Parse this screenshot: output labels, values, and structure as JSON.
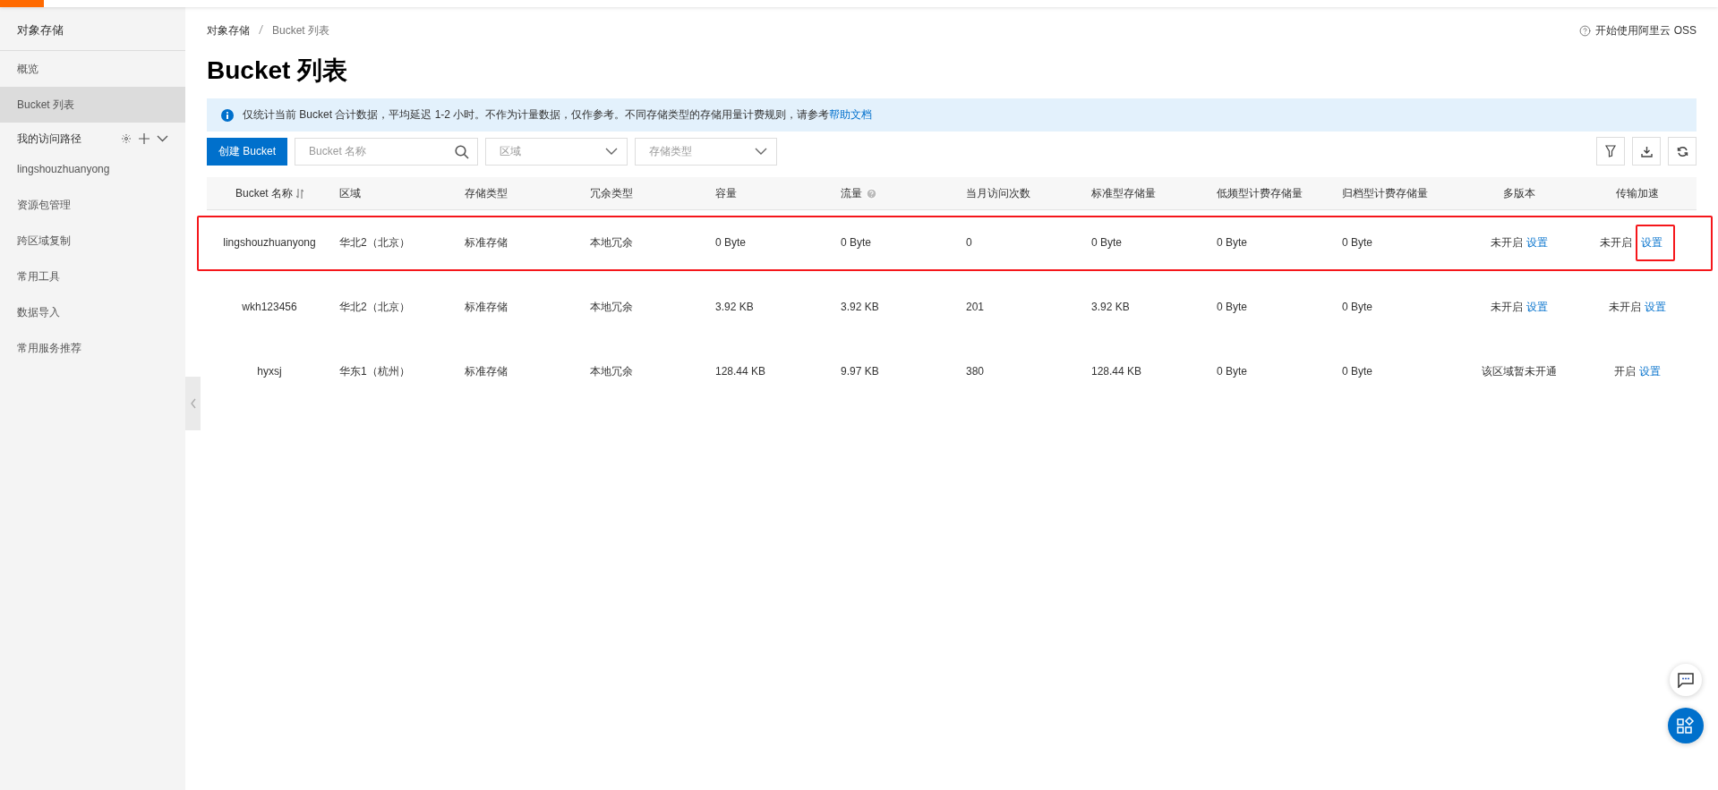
{
  "sidebar": {
    "title": "对象存储",
    "items": [
      {
        "label": "概览",
        "selected": false,
        "kind": "link"
      },
      {
        "label": "Bucket 列表",
        "selected": true,
        "kind": "link"
      },
      {
        "label": "我的访问路径",
        "selected": false,
        "kind": "group"
      },
      {
        "label": "lingshouzhuanyong",
        "selected": false,
        "kind": "link"
      },
      {
        "label": "资源包管理",
        "selected": false,
        "kind": "link"
      },
      {
        "label": "跨区域复制",
        "selected": false,
        "kind": "link"
      },
      {
        "label": "常用工具",
        "selected": false,
        "kind": "link"
      },
      {
        "label": "数据导入",
        "selected": false,
        "kind": "link"
      },
      {
        "label": "常用服务推荐",
        "selected": false,
        "kind": "link"
      }
    ]
  },
  "breadcrumb": [
    "对象存储",
    "Bucket 列表"
  ],
  "help_link": "开始使用阿里云 OSS",
  "page_title": "Bucket 列表",
  "notice": {
    "text": "仅统计当前 Bucket 合计数据，平均延迟 1-2 小时。不作为计量数据，仅作参考。不同存储类型的存储用量计费规则，请参考",
    "link": "帮助文档"
  },
  "toolbar": {
    "create_button": "创建 Bucket",
    "search": {
      "placeholder": "Bucket 名称"
    },
    "region_select": {
      "placeholder": "区域"
    },
    "storage_select": {
      "placeholder": "存储类型"
    }
  },
  "table": {
    "columns": [
      {
        "label": "Bucket 名称",
        "sortable": true,
        "help": false
      },
      {
        "label": "区域",
        "sortable": false,
        "help": false
      },
      {
        "label": "存储类型",
        "sortable": false,
        "help": false
      },
      {
        "label": "冗余类型",
        "sortable": false,
        "help": false
      },
      {
        "label": "容量",
        "sortable": false,
        "help": false
      },
      {
        "label": "流量",
        "sortable": false,
        "help": true
      },
      {
        "label": "当月访问次数",
        "sortable": false,
        "help": false
      },
      {
        "label": "标准型存储量",
        "sortable": false,
        "help": false
      },
      {
        "label": "低频型计费存储量",
        "sortable": false,
        "help": false
      },
      {
        "label": "归档型计费存储量",
        "sortable": false,
        "help": false
      },
      {
        "label": "多版本",
        "sortable": false,
        "help": false
      },
      {
        "label": "传输加速",
        "sortable": false,
        "help": false
      }
    ],
    "rows": [
      {
        "highlighted": true,
        "cells": [
          "lingshouzhuanyong",
          "华北2（北京）",
          "标准存储",
          "本地冗余",
          "0 Byte",
          "0 Byte",
          "0",
          "0 Byte",
          "0 Byte",
          "0 Byte"
        ],
        "versioning": {
          "status": "未开启",
          "link": "设置"
        },
        "acceleration": {
          "status": "未开启",
          "link": "设置",
          "highlighted": true
        }
      },
      {
        "highlighted": false,
        "cells": [
          "wkh123456",
          "华北2（北京）",
          "标准存储",
          "本地冗余",
          "3.92 KB",
          "3.92 KB",
          "201",
          "3.92 KB",
          "0 Byte",
          "0 Byte"
        ],
        "versioning": {
          "status": "未开启",
          "link": "设置"
        },
        "acceleration": {
          "status": "未开启",
          "link": "设置",
          "highlighted": false
        }
      },
      {
        "highlighted": false,
        "cells": [
          "hyxsj",
          "华东1（杭州）",
          "标准存储",
          "本地冗余",
          "128.44 KB",
          "9.97 KB",
          "380",
          "128.44 KB",
          "0 Byte",
          "0 Byte"
        ],
        "versioning": {
          "status": "该区域暂未开通"
        },
        "acceleration": {
          "status": "开启",
          "link": "设置",
          "highlighted": false
        }
      }
    ]
  }
}
